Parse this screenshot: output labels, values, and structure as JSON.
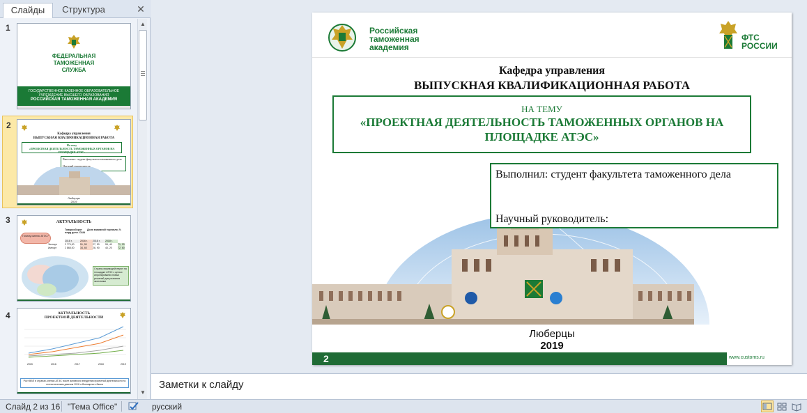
{
  "left_pane": {
    "tabs": [
      {
        "label": "Слайды",
        "selected": true
      },
      {
        "label": "Структура",
        "selected": false
      }
    ],
    "close_glyph": "✕",
    "thumbnails": [
      {
        "number": "1",
        "title_lines": [
          "ФЕДЕРАЛЬНАЯ",
          "ТАМОЖЕННАЯ",
          "СЛУЖБА"
        ],
        "band_lines": [
          "ГОСУДАРСТВЕННОЕ КАЗЕННОЕ ОБРАЗОВАТЕЛЬНОЕ",
          "УЧРЕЖДЕНИЕ ВЫСШЕГО ОБРАЗОВАНИЯ",
          "РОССИЙСКАЯ ТАМОЖЕННАЯ АКАДЕМИЯ"
        ]
      },
      {
        "number": "2",
        "selected": true,
        "line1": "Кафедра управления",
        "line2": "ВЫПУСКНАЯ КВАЛИФИКАЦИОННАЯ РАБОТА",
        "topic_small": "На тему",
        "topic": "«ПРОЕКТНАЯ ДЕЯТЕЛЬНОСТЬ ТАМОЖЕННЫХ ОРГАНОВ НА ПЛОЩАДКЕ АТЭС»",
        "author": "Выполнил: студент факультета таможенного дела",
        "supervisor": "Научный руководитель:",
        "city": "Люберцы",
        "year": "2019"
      },
      {
        "number": "3",
        "title": "АКТУАЛЬНОСТЬ",
        "bubble": "Почему именно АТЭС?",
        "table_caption": "Товарооборот млрд долл. США",
        "share_caption": "Доля взаимной торговли, %",
        "headers": [
          "",
          "2018 г.",
          "2016 г.",
          "2018 г.",
          "2018 г."
        ],
        "rows": [
          {
            "label": "Экспорт",
            "values": [
              "2 779,00",
              "51, 50",
              "27, 50",
              "55, 40",
              "71, 20"
            ]
          },
          {
            "label": "Импорт",
            "values": [
              "2 868,00",
              "34, 60",
              "26, 90",
              "40, 20",
              "72, 60"
            ]
          }
        ],
        "note": "Страны взаимодействуют на площадке АТЭС с целью апробирования новых решений для развития экономики"
      },
      {
        "number": "4",
        "title": "АКТУАЛЬНОСТЬ\nПРОЕКТНОЙ ДЕЯТЕЛЬНОСТИ",
        "x_labels": [
          "2015",
          "2016",
          "2017",
          "2018",
          "2019"
        ],
        "footer_text": "Рост ВВП в странах-членах АТЭС после активного внедрения проектной деятельности по статистическим данным ООН и Всемирного банка"
      }
    ]
  },
  "slide": {
    "academy_logo_text": [
      "Российская",
      "таможенная",
      "академия"
    ],
    "fts_logo_text": [
      "ФТС",
      "РОССИИ"
    ],
    "line1": "Кафедра управления",
    "line2": "ВЫПУСКНАЯ КВАЛИФИКАЦИОННАЯ РАБОТА",
    "topic_small": "НА ТЕМУ",
    "topic": "«ПРОЕКТНАЯ ДЕЯТЕЛЬНОСТЬ ТАМОЖЕННЫХ ОРГАНОВ НА ПЛОЩАДКЕ АТЭС»",
    "author": "Выполнил:  студент факультета таможенного  дела",
    "supervisor": "Научный  руководитель:",
    "city": "Люберцы",
    "year": "2019",
    "slide_number": "2",
    "footer_url": "www.customs.ru"
  },
  "notes": {
    "placeholder": "Заметки к слайду"
  },
  "status_bar": {
    "slide_counter": "Слайд 2 из 16",
    "theme": "\"Тема Office\"",
    "language": "русский"
  },
  "colors": {
    "brand_green": "#1b7a36",
    "selection": "#fce9a8"
  }
}
